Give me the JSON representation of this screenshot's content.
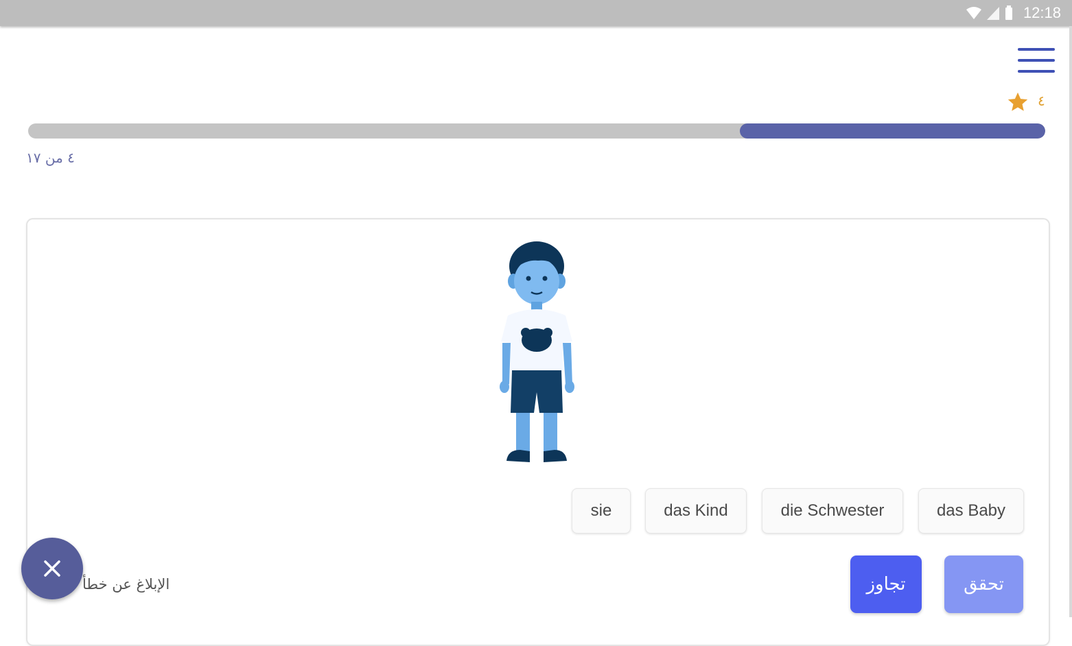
{
  "status_bar": {
    "time": "12:18",
    "icons": [
      "wifi-icon",
      "signal-icon",
      "battery-icon"
    ]
  },
  "header": {
    "menu_icon": "hamburger-menu-icon",
    "score": {
      "count": "٤",
      "icon": "star-icon",
      "color": "#e8a030"
    }
  },
  "progress": {
    "fraction": 0.3,
    "label": "٤ من ١٧",
    "fill_color": "#5a63a8"
  },
  "exercise": {
    "image": "boy-illustration",
    "choices": [
      {
        "label": "sie"
      },
      {
        "label": "das Kind"
      },
      {
        "label": "die Schwester"
      },
      {
        "label": "das Baby"
      }
    ]
  },
  "actions": {
    "skip_label": "تجاوز",
    "check_label": "تحقق",
    "report_label": "الإبلاغ عن خطأ",
    "close_icon": "close-icon"
  },
  "colors": {
    "accent": "#4d5ef0",
    "accent_light": "#8596f3",
    "fab": "#565d9a"
  }
}
